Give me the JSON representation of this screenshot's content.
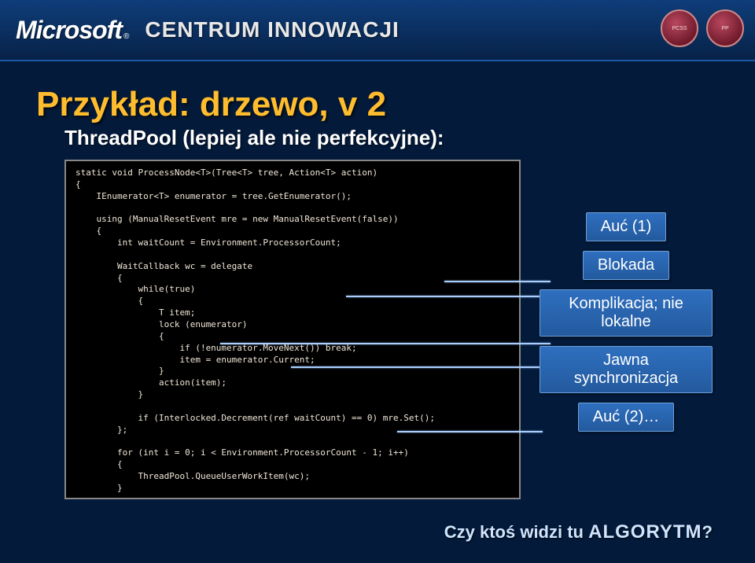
{
  "header": {
    "logo_text": "Microsoft",
    "logo_r": "®",
    "centrum": "CENTRUM INNOWACJI",
    "seal1": "PCSS",
    "seal2": "PP"
  },
  "slide": {
    "title": "Przykład: drzewo, v 2",
    "subtitle": "ThreadPool (lepiej ale nie perfekcyjne):",
    "code": "static void ProcessNode<T>(Tree<T> tree, Action<T> action)\n{\n    IEnumerator<T> enumerator = tree.GetEnumerator();\n\n    using (ManualResetEvent mre = new ManualResetEvent(false))\n    {\n        int waitCount = Environment.ProcessorCount;\n\n        WaitCallback wc = delegate\n        {\n            while(true)\n            {\n                T item;\n                lock (enumerator)\n                {\n                    if (!enumerator.MoveNext()) break;\n                    item = enumerator.Current;\n                }\n                action(item);\n            }\n\n            if (Interlocked.Decrement(ref waitCount) == 0) mre.Set();\n        };\n\n        for (int i = 0; i < Environment.ProcessorCount - 1; i++)\n        {\n            ThreadPool.QueueUserWorkItem(wc);\n        }\n\n        wc(null);\n        mre.WaitOne();\n    }\n}"
  },
  "callouts": {
    "c1": "Auć (1)",
    "c2": "Blokada",
    "c3": "Komplikacja; nie lokalne",
    "c4": "Jawna synchronizacja",
    "c5": "Auć (2)…"
  },
  "question": {
    "prefix": "Czy ktoś widzi tu ",
    "big": "ALGORYTM",
    "suffix": "?"
  }
}
